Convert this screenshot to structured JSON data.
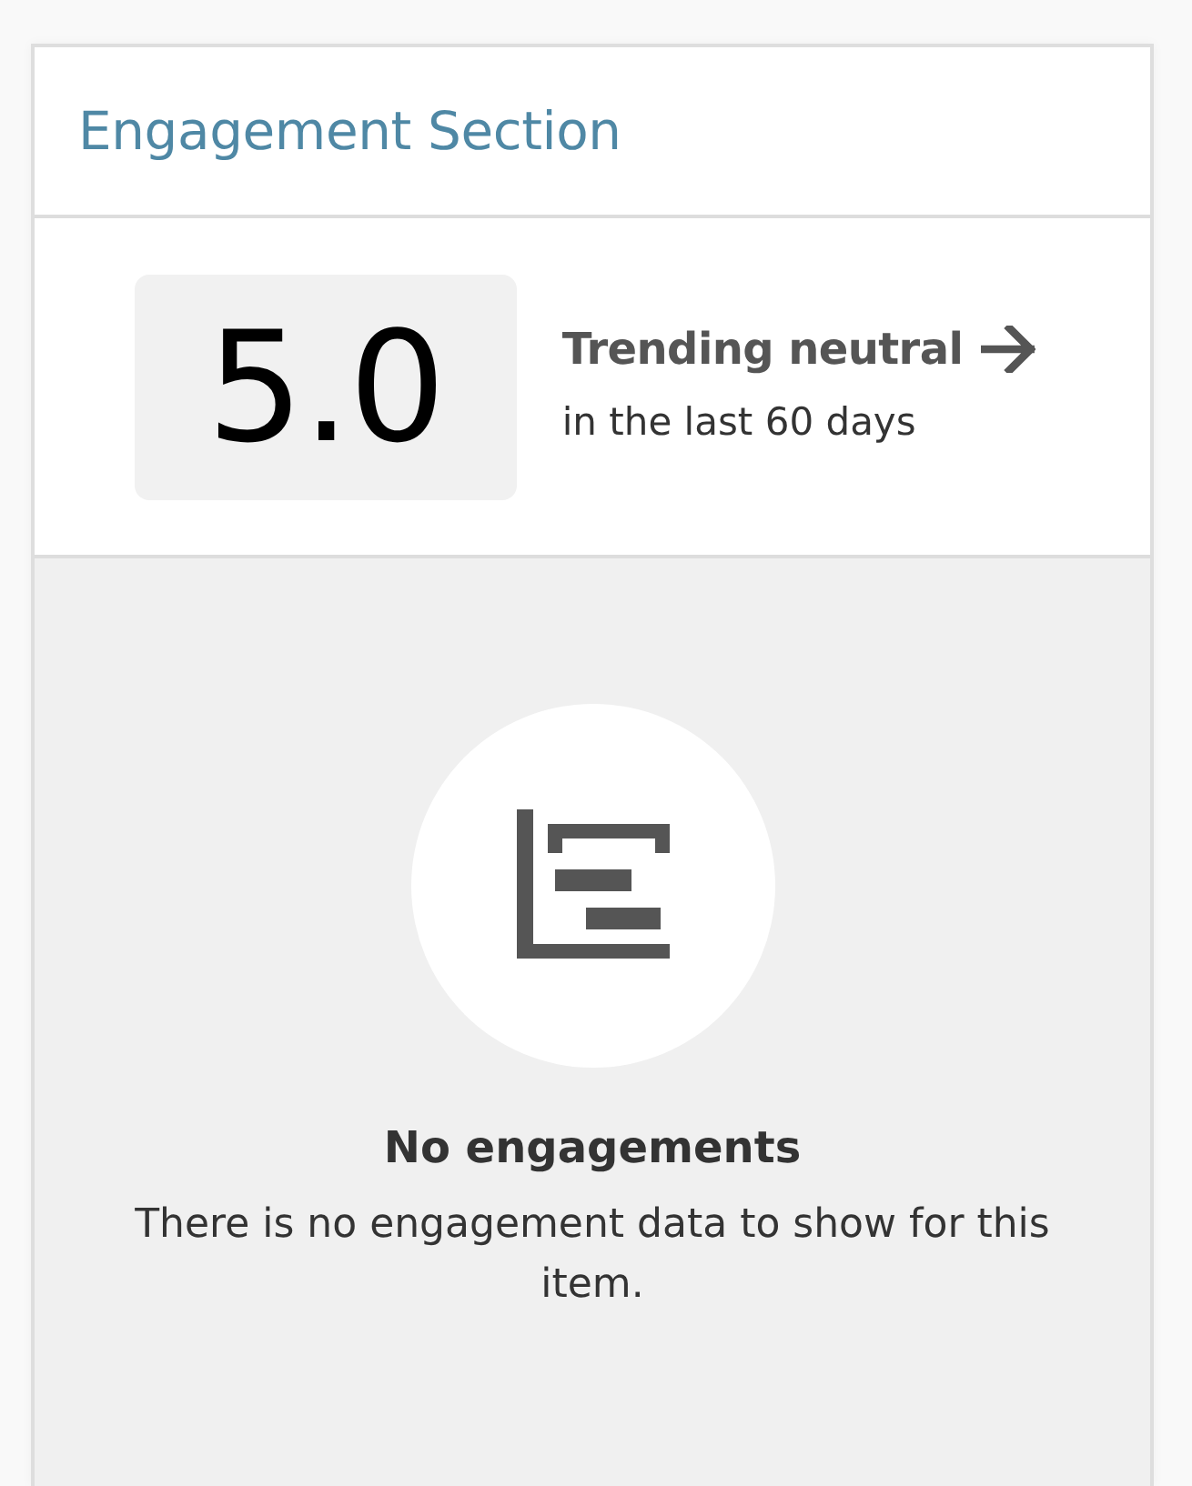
{
  "card": {
    "title": "Engagement Section"
  },
  "score": {
    "value": "5.0",
    "trend": {
      "label": "Trending neutral",
      "kind": "neutral"
    },
    "period": "in the last 60 days"
  },
  "empty_state": {
    "title": "No engagements",
    "message": "There is no engagement data to show for this item."
  }
}
